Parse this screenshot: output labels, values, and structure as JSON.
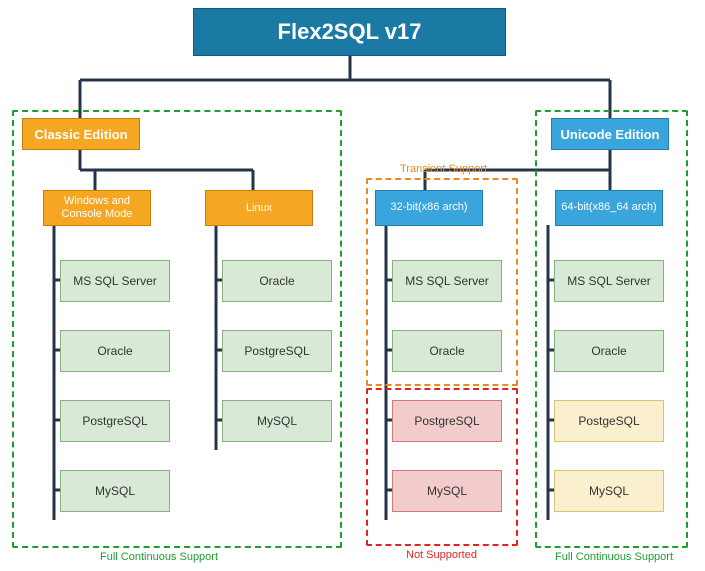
{
  "root": {
    "title": "Flex2SQL v17"
  },
  "classic": {
    "label": "Classic Edition",
    "windows": {
      "label": "Windows and Console Mode",
      "dbs": [
        "MS SQL Server",
        "Oracle",
        "PostgreSQL",
        "MySQL"
      ]
    },
    "linux": {
      "label": "Linux",
      "dbs": [
        "Oracle",
        "PostgreSQL",
        "MySQL"
      ]
    }
  },
  "unicode": {
    "label": "Unicode Edition",
    "x86": {
      "lines": [
        "32-bit",
        "(x86 arch)"
      ],
      "supported": [
        "MS SQL Server",
        "Oracle"
      ],
      "unsupported": [
        "PostgreSQL",
        "MySQL"
      ]
    },
    "x64": {
      "lines": [
        "64-bit",
        "(x86_64 arch)"
      ],
      "dbs": [
        "MS SQL Server",
        "Oracle",
        "PostgeSQL",
        "MySQL"
      ]
    }
  },
  "zones": {
    "transient": "Transient Support",
    "not_supported": "Not Supported",
    "full": "Full Continuous Support"
  }
}
